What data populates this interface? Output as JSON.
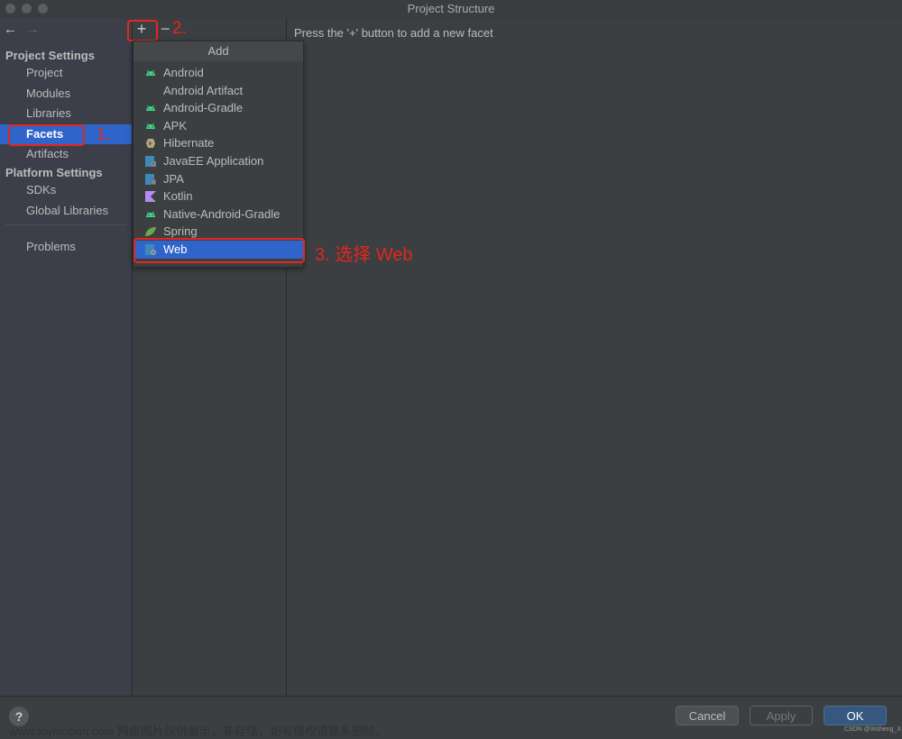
{
  "window": {
    "title": "Project Structure",
    "back_arrow": "←",
    "forward_arrow": "→"
  },
  "sidebar": {
    "sections": [
      {
        "label": "Project Settings"
      },
      {
        "label": "Platform Settings"
      }
    ],
    "items": [
      {
        "label": "Project"
      },
      {
        "label": "Modules"
      },
      {
        "label": "Libraries"
      },
      {
        "label": "Facets",
        "selected": true
      },
      {
        "label": "Artifacts"
      },
      {
        "label": "SDKs"
      },
      {
        "label": "Global Libraries"
      },
      {
        "label": "Problems"
      }
    ]
  },
  "toolbar": {
    "add_label": "+",
    "remove_label": "−"
  },
  "add_popup": {
    "header": "Add",
    "items": [
      {
        "label": "Android",
        "icon": "android-icon"
      },
      {
        "label": "Android Artifact",
        "icon": ""
      },
      {
        "label": "Android-Gradle",
        "icon": "android-icon"
      },
      {
        "label": "APK",
        "icon": "android-icon"
      },
      {
        "label": "Hibernate",
        "icon": "hibernate-icon"
      },
      {
        "label": "JavaEE Application",
        "icon": "javaee-icon"
      },
      {
        "label": "JPA",
        "icon": "jpa-icon"
      },
      {
        "label": "Kotlin",
        "icon": "kotlin-icon"
      },
      {
        "label": "Native-Android-Gradle",
        "icon": "android-icon"
      },
      {
        "label": "Spring",
        "icon": "spring-icon"
      },
      {
        "label": "Web",
        "icon": "web-icon",
        "selected": true
      }
    ]
  },
  "content": {
    "hint": "Press the '+' button to add a new facet"
  },
  "annotations": {
    "step1": "1.",
    "step2": "2.",
    "step3": "3. 选择 Web"
  },
  "footer": {
    "help_label": "?",
    "cancel_label": "Cancel",
    "apply_label": "Apply",
    "ok_label": "OK"
  },
  "watermark": {
    "text": "www.toymoban.com 网络图片仅供展示，非存储，如有侵权请联系删除。",
    "credit": "CSDN @Wsheng_X"
  },
  "colors": {
    "selection": "#2f65ca",
    "annotation_red": "#e3261f",
    "ok_button": "#365880",
    "android_green": "#3ddc84"
  }
}
